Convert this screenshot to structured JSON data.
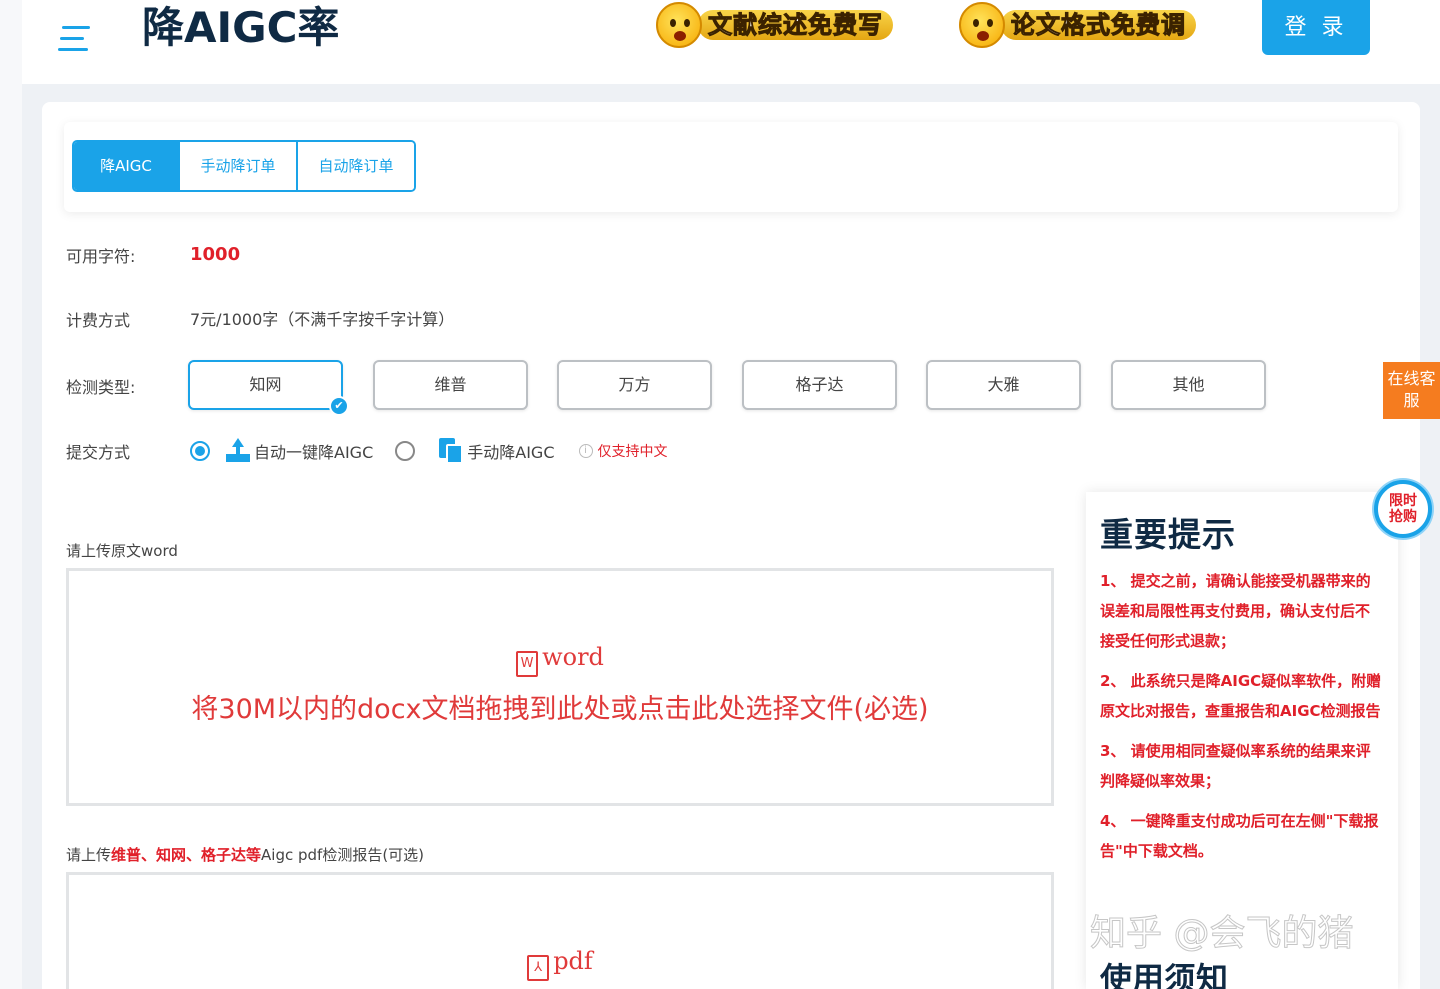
{
  "header": {
    "title": "降AIGC率",
    "promo_left": "文献综述免费写",
    "promo_right": "论文格式免费调",
    "login_label": "登 录"
  },
  "tabs": [
    {
      "label": "降AIGC",
      "active": true
    },
    {
      "label": "手动降订单",
      "active": false
    },
    {
      "label": "自动降订单",
      "active": false
    }
  ],
  "form": {
    "credits_label": "可用字符:",
    "credits_value": "1000",
    "billing_label": "计费方式",
    "billing_value": "7元/1000字（不满千字按千字计算）",
    "detection_label": "检测类型:",
    "detection_options": [
      "知网",
      "维普",
      "万方",
      "格子达",
      "大雅",
      "其他"
    ],
    "detection_selected": "知网",
    "submit_label": "提交方式",
    "submit_option_auto": "自动一键降AIGC",
    "submit_option_manual": "手动降AIGC",
    "submit_selected": "自动一键降AIGC",
    "note": "仅支持中文"
  },
  "upload_word": {
    "label": "请上传原文word",
    "file_type": "word",
    "hint": "将30M以内的docx文档拖拽到此处或点击此处选择文件(必选)"
  },
  "upload_pdf": {
    "label_prefix": "请上传",
    "label_highlight": "维普、知网、格子达等",
    "label_suffix": "Aigc pdf检测报告(可选)",
    "file_type": "pdf"
  },
  "notice": {
    "title": "重要提示",
    "items": [
      "1、 提交之前，请确认能接受机器带来的误差和局限性再支付费用，确认支付后不接受任何形式退款；",
      "2、 此系统只是降AIGC疑似率软件，附赠原文比对报告，查重报告和AIGC检测报告",
      "3、 请使用相同查疑似率系统的结果来评判降疑似率效果；",
      "4、 一键降重支付成功后可在左侧\"下载报告\"中下载文档。"
    ],
    "next_title": "使用须知"
  },
  "side": {
    "service": "在线客服",
    "limited": "限时抢购"
  },
  "watermark": "知乎 @会飞的猪",
  "colors": {
    "accent": "#1aa3e8",
    "danger": "#e0202a",
    "service": "#f57c1f",
    "title": "#0f2a44"
  }
}
